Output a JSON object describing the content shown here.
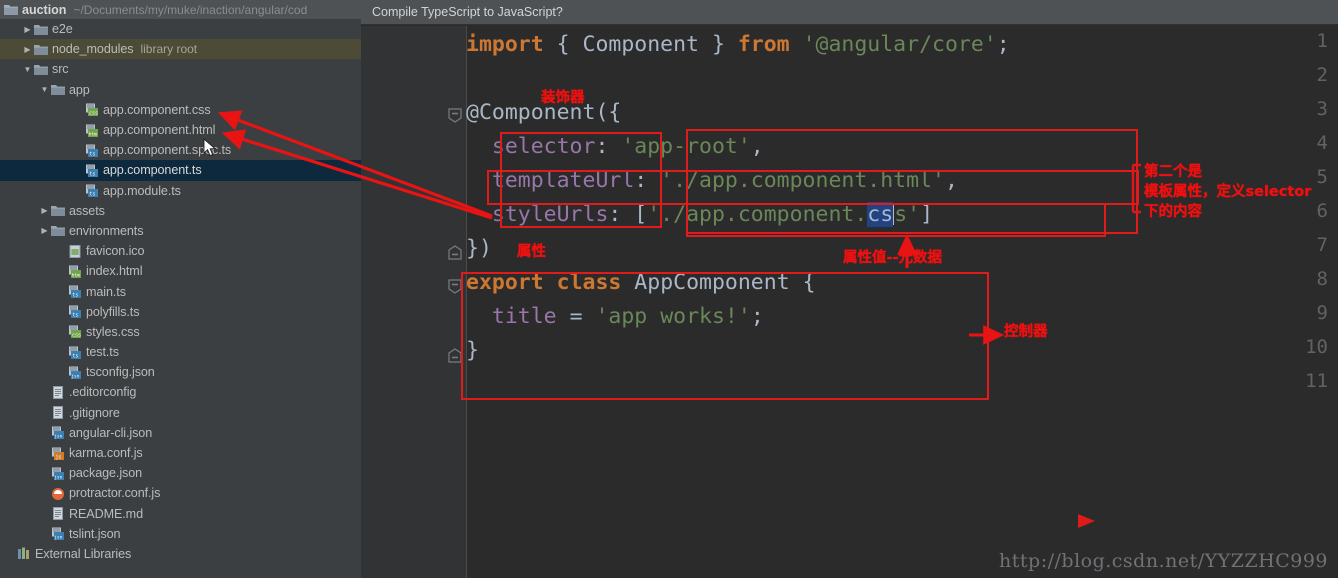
{
  "window": {
    "project_name": "auction",
    "project_path": "~/Documents/my/muke/inaction/angular/cod",
    "watermark": "http://blog.csdn.net/YYZZHC999"
  },
  "notification": {
    "text": "Compile TypeScript to JavaScript?"
  },
  "tree": [
    {
      "label": "e2e",
      "indent": 1,
      "arrow": "▶",
      "icon": "folder-icon",
      "state": "normal"
    },
    {
      "label": "node_modules",
      "indent": 1,
      "arrow": "▶",
      "icon": "folder-icon",
      "state": "highlight",
      "suffix": "library root"
    },
    {
      "label": "src",
      "indent": 1,
      "arrow": "▼",
      "icon": "folder-icon",
      "state": "normal"
    },
    {
      "label": "app",
      "indent": 2,
      "arrow": "▼",
      "icon": "folder-icon",
      "state": "normal"
    },
    {
      "label": "app.component.css",
      "indent": 4,
      "arrow": "",
      "icon": "css-file-icon",
      "state": "normal"
    },
    {
      "label": "app.component.html",
      "indent": 4,
      "arrow": "",
      "icon": "html-file-icon",
      "state": "normal"
    },
    {
      "label": "app.component.spec.ts",
      "indent": 4,
      "arrow": "",
      "icon": "ts-file-icon",
      "state": "normal"
    },
    {
      "label": "app.component.ts",
      "indent": 4,
      "arrow": "",
      "icon": "ts-file-icon",
      "state": "selected"
    },
    {
      "label": "app.module.ts",
      "indent": 4,
      "arrow": "",
      "icon": "ts-file-icon",
      "state": "normal"
    },
    {
      "label": "assets",
      "indent": 2,
      "arrow": "▶",
      "icon": "folder-icon",
      "state": "normal"
    },
    {
      "label": "environments",
      "indent": 2,
      "arrow": "▶",
      "icon": "folder-icon",
      "state": "normal"
    },
    {
      "label": "favicon.ico",
      "indent": 3,
      "arrow": "",
      "icon": "image-file-icon",
      "state": "normal"
    },
    {
      "label": "index.html",
      "indent": 3,
      "arrow": "",
      "icon": "html-file-icon",
      "state": "normal"
    },
    {
      "label": "main.ts",
      "indent": 3,
      "arrow": "",
      "icon": "ts-file-icon",
      "state": "normal"
    },
    {
      "label": "polyfills.ts",
      "indent": 3,
      "arrow": "",
      "icon": "ts-file-icon",
      "state": "normal"
    },
    {
      "label": "styles.css",
      "indent": 3,
      "arrow": "",
      "icon": "css-file-icon",
      "state": "normal"
    },
    {
      "label": "test.ts",
      "indent": 3,
      "arrow": "",
      "icon": "ts-file-icon",
      "state": "normal"
    },
    {
      "label": "tsconfig.json",
      "indent": 3,
      "arrow": "",
      "icon": "json-file-icon",
      "state": "normal"
    },
    {
      "label": ".editorconfig",
      "indent": 2,
      "arrow": "",
      "icon": "text-file-icon",
      "state": "normal"
    },
    {
      "label": ".gitignore",
      "indent": 2,
      "arrow": "",
      "icon": "text-file-icon",
      "state": "normal"
    },
    {
      "label": "angular-cli.json",
      "indent": 2,
      "arrow": "",
      "icon": "json-file-icon",
      "state": "normal"
    },
    {
      "label": "karma.conf.js",
      "indent": 2,
      "arrow": "",
      "icon": "js-file-icon",
      "state": "normal"
    },
    {
      "label": "package.json",
      "indent": 2,
      "arrow": "",
      "icon": "json-file-icon",
      "state": "normal"
    },
    {
      "label": "protractor.conf.js",
      "indent": 2,
      "arrow": "",
      "icon": "protractor-file-icon",
      "state": "normal"
    },
    {
      "label": "README.md",
      "indent": 2,
      "arrow": "",
      "icon": "text-file-icon",
      "state": "normal"
    },
    {
      "label": "tslint.json",
      "indent": 2,
      "arrow": "",
      "icon": "json-file-icon",
      "state": "normal"
    },
    {
      "label": "External Libraries",
      "indent": 0,
      "arrow": "",
      "icon": "library-icon",
      "state": "normal"
    }
  ],
  "editor": {
    "line_numbers": [
      "1",
      "2",
      "3",
      "4",
      "5",
      "6",
      "7",
      "8",
      "9",
      "10",
      "11"
    ],
    "lines": [
      {
        "n": 1,
        "text": "import { Component } from '@angular/core';"
      },
      {
        "n": 2,
        "text": ""
      },
      {
        "n": 3,
        "text": "@Component({"
      },
      {
        "n": 4,
        "text": "  selector: 'app-root',"
      },
      {
        "n": 5,
        "text": "  templateUrl: './app.component.html',"
      },
      {
        "n": 6,
        "text": "  styleUrls: ['./app.component.css']"
      },
      {
        "n": 7,
        "text": "})"
      },
      {
        "n": 8,
        "text": "export class AppComponent {"
      },
      {
        "n": 9,
        "text": "  title = 'app works!';"
      },
      {
        "n": 10,
        "text": "}"
      },
      {
        "n": 11,
        "text": ""
      }
    ]
  },
  "annotations": [
    {
      "id": "decorator",
      "text": "装饰器"
    },
    {
      "id": "property",
      "text": "属性"
    },
    {
      "id": "prop-value",
      "text": "属性值--元数据"
    },
    {
      "id": "controller",
      "text": "控制器"
    },
    {
      "id": "template-note",
      "text": "第二个是\n模板属性，定义selector\n下的内容"
    }
  ],
  "colors": {
    "annotation_red": "#f01010",
    "box_red": "#e01b1b",
    "sidebar_bg": "#3c3f41",
    "editor_bg": "#2b2b2b",
    "selection_blue": "#214283",
    "keyword_orange": "#cc7832",
    "string_green": "#6a8759",
    "property_purple": "#9876aa"
  }
}
